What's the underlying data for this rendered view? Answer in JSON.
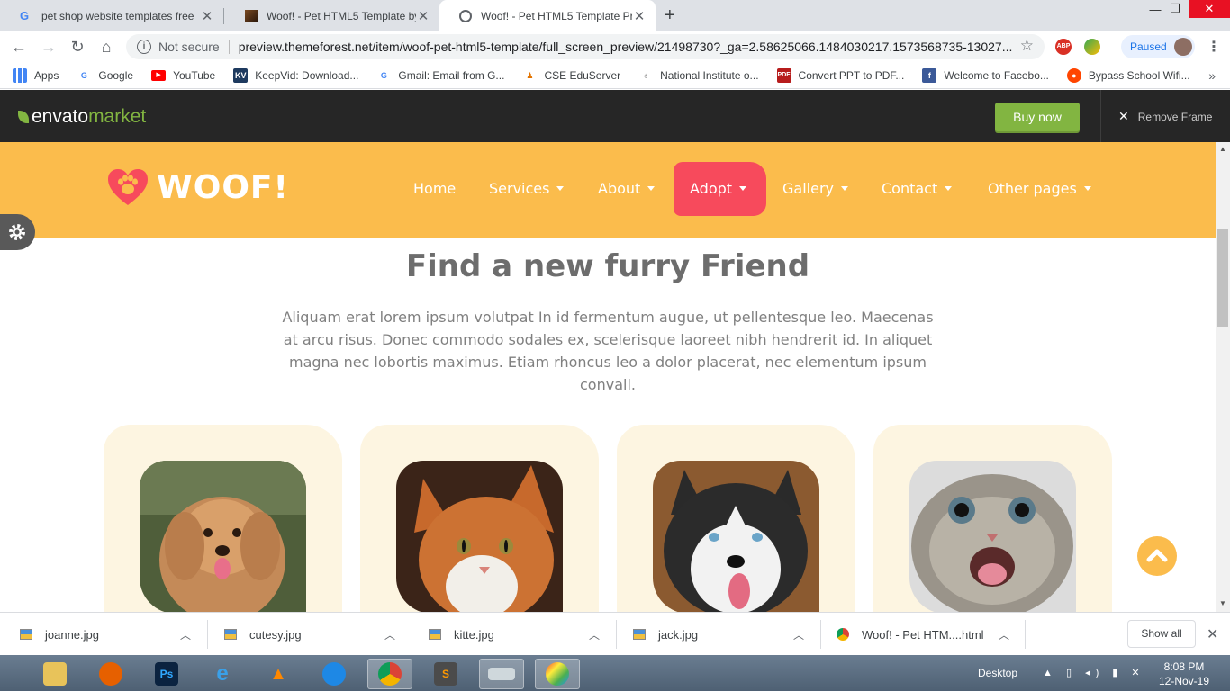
{
  "browser": {
    "tabs": [
      {
        "label": "pet shop website templates free",
        "icon": "google-icon"
      },
      {
        "label": "Woof! - Pet HTML5 Template by",
        "icon": "woof-favicon"
      },
      {
        "label": "Woof! - Pet HTML5 Template Pre",
        "icon": "globe-icon",
        "active": true
      }
    ],
    "security_label": "Not secure",
    "url": "preview.themeforest.net/item/woof-pet-html5-template/full_screen_preview/21498730?_ga=2.58625066.1484030217.1573568735-13027...",
    "extensions": [
      "ABP"
    ],
    "profile_status": "Paused",
    "bookmarks": [
      {
        "label": "Apps",
        "icon": "apps-grid-icon"
      },
      {
        "label": "Google",
        "icon": "google-icon"
      },
      {
        "label": "YouTube",
        "icon": "youtube-icon"
      },
      {
        "label": "KeepVid: Download...",
        "icon": "keepvid-icon"
      },
      {
        "label": "Gmail: Email from G...",
        "icon": "google-icon"
      },
      {
        "label": "CSE EduServer",
        "icon": "graduation-cap-icon"
      },
      {
        "label": "National Institute o...",
        "icon": "institute-icon"
      },
      {
        "label": "Convert PPT to PDF...",
        "icon": "pdf-icon"
      },
      {
        "label": "Welcome to Facebo...",
        "icon": "facebook-icon"
      },
      {
        "label": "Bypass School Wifi...",
        "icon": "reddit-icon"
      }
    ]
  },
  "envato": {
    "logo_text": "envato",
    "logo_market": "market",
    "buy_now": "Buy now",
    "remove_frame": "Remove Frame"
  },
  "site": {
    "brand": "WOOF!",
    "menu": [
      {
        "label": "Home",
        "dropdown": false
      },
      {
        "label": "Services",
        "dropdown": true
      },
      {
        "label": "About",
        "dropdown": true
      },
      {
        "label": "Adopt",
        "dropdown": true,
        "active": true
      },
      {
        "label": "Gallery",
        "dropdown": true
      },
      {
        "label": "Contact",
        "dropdown": true
      },
      {
        "label": "Other pages",
        "dropdown": true
      }
    ],
    "section_title": "Find a new furry Friend",
    "section_lead": "Aliquam erat lorem ipsum volutpat In id fermentum augue, ut pellentesque leo. Maecenas at arcu risus. Donec commodo sodales ex, scelerisque laoreet nibh hendrerit id. In aliquet magna nec lobortis maximus. Etiam rhoncus leo a dolor placerat, nec elementum ipsum convall.",
    "pets": [
      {
        "kind": "poodle"
      },
      {
        "kind": "cat"
      },
      {
        "kind": "husky"
      },
      {
        "kind": "kitten"
      }
    ],
    "colors": {
      "nav": "#fbbc4c",
      "accent": "#f74a5c",
      "card": "#fdf5e1"
    }
  },
  "downloads": {
    "items": [
      "joanne.jpg",
      "cutesy.jpg",
      "kitte.jpg",
      "jack.jpg",
      "Woof! - Pet HTM....html"
    ],
    "show_all": "Show all"
  },
  "taskbar": {
    "desktop_label": "Desktop",
    "time": "8:08 PM",
    "date": "12-Nov-19"
  }
}
